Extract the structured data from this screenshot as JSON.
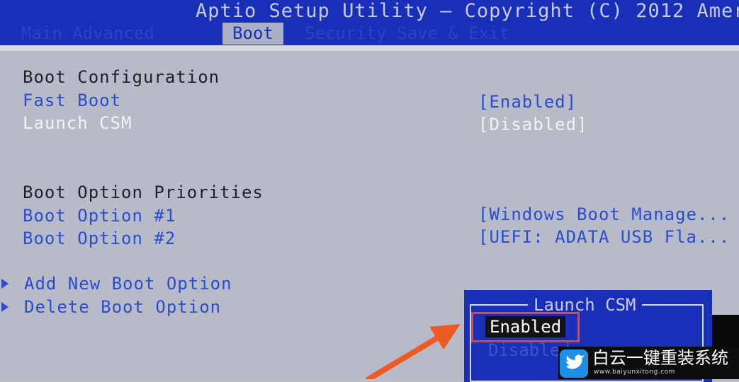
{
  "header": {
    "title": "Aptio Setup Utility – Copyright (C) 2012 Amer",
    "tabs": [
      {
        "label": "Main Advanced",
        "active": false
      },
      {
        "label": "Boot",
        "active": true
      },
      {
        "label": "Security Save & Exit",
        "active": false
      }
    ]
  },
  "main": {
    "sections": [
      {
        "heading": "Boot Configuration",
        "items": [
          {
            "label": "Fast Boot",
            "value": "[Enabled]",
            "selected": false
          },
          {
            "label": "Launch CSM",
            "value": "[Disabled]",
            "selected": true
          }
        ]
      },
      {
        "heading": "Boot Option Priorities",
        "items": [
          {
            "label": "Boot Option #1",
            "value": "[Windows Boot Manage...",
            "selected": false
          },
          {
            "label": "Boot Option #2",
            "value": "[UEFI: ADATA USB Fla...",
            "selected": false
          }
        ]
      }
    ],
    "submenus": [
      {
        "label": "Add New Boot Option"
      },
      {
        "label": "Delete Boot Option"
      }
    ]
  },
  "popup": {
    "title": "Launch CSM",
    "options": [
      {
        "label": "Enabled",
        "selected": true
      },
      {
        "label": "Disabled",
        "selected": false
      }
    ]
  },
  "watermark": {
    "name": "白云一键重装系统",
    "url": "www.baiyunxitong.com",
    "icon": "bird-icon"
  },
  "colors": {
    "header_bg": "#1a2fb8",
    "panel_bg": "#b7bbc7",
    "item_text": "#2b4bd3",
    "heading_text": "#1f2029",
    "selected_text": "#f2f3f7",
    "highlight": "#e8452c"
  }
}
